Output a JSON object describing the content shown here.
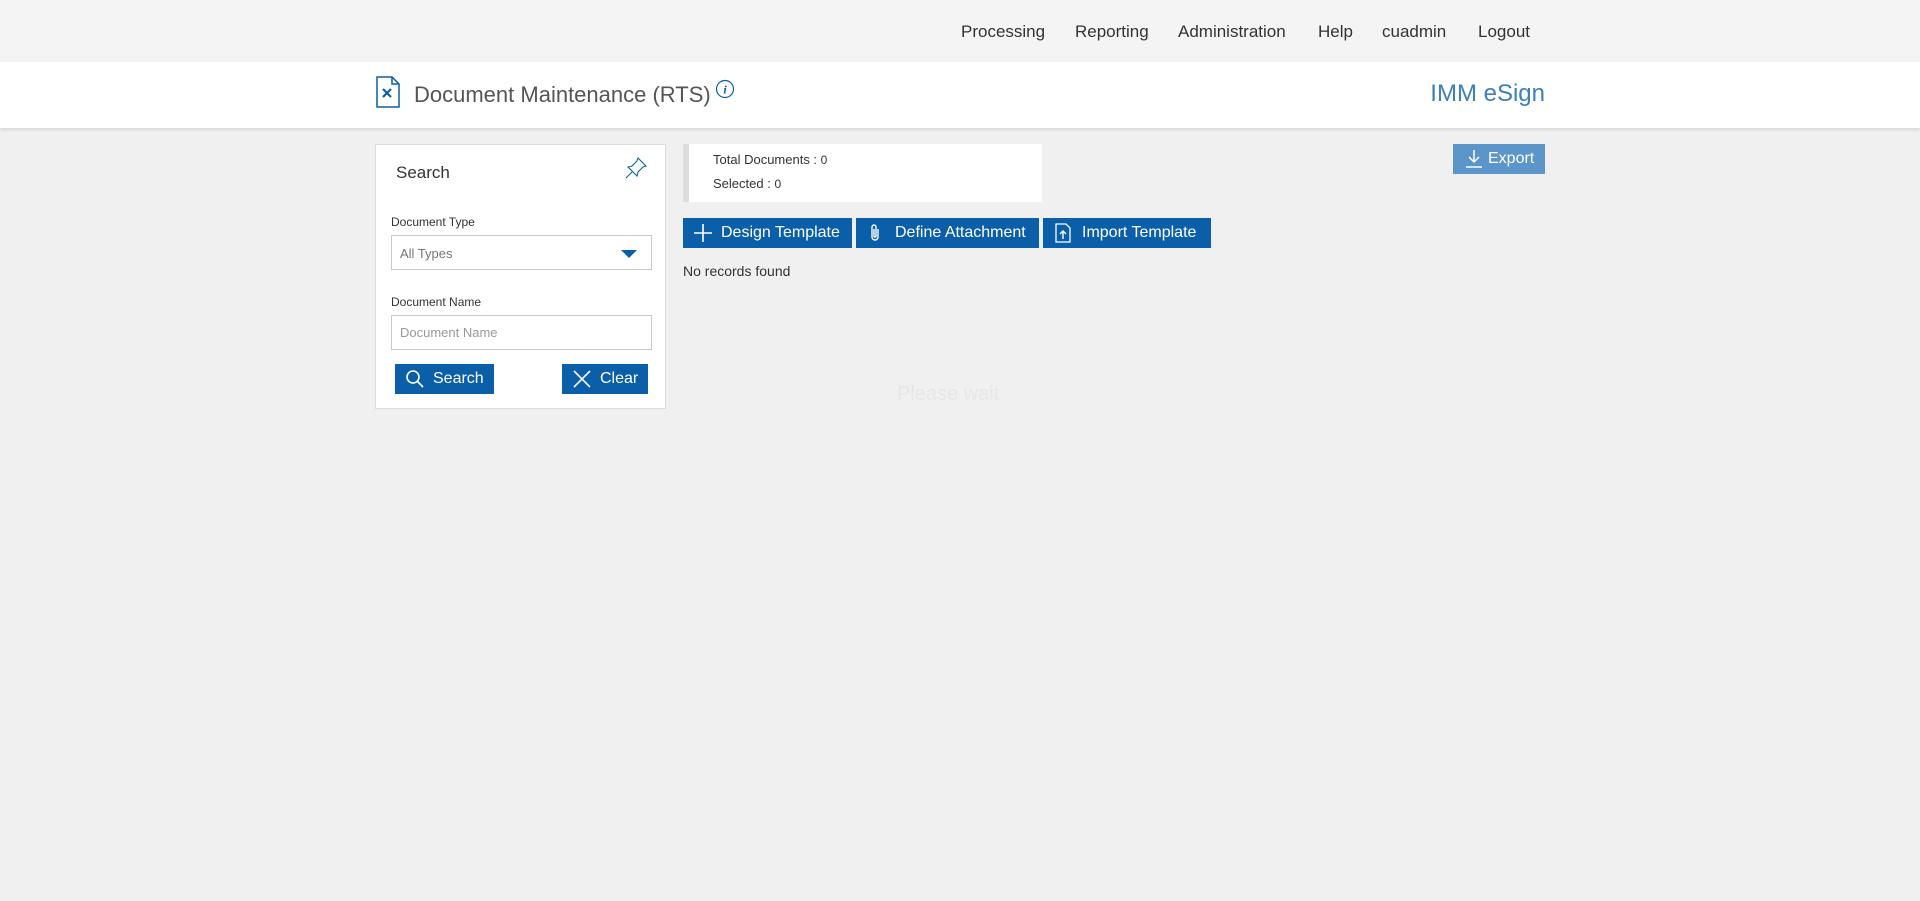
{
  "nav": {
    "items": [
      "Processing",
      "Reporting",
      "Administration",
      "Help",
      "cuadmin",
      "Logout"
    ]
  },
  "header": {
    "title": "Document Maintenance (RTS)",
    "brand": "IMM eSign",
    "icons": [
      "document-icon",
      "info-icon"
    ]
  },
  "search": {
    "title": "Search",
    "document_type_label": "Document Type",
    "document_type_value": "All Types",
    "document_name_label": "Document Name",
    "document_name_placeholder": "Document Name",
    "search_button": "Search",
    "clear_button": "Clear"
  },
  "summary": {
    "total_label": "Total Documents : ",
    "total_value": "0",
    "selected_label": "Selected : ",
    "selected_value": "0"
  },
  "actions": {
    "design_template": "Design Template",
    "define_attachment": "Define Attachment",
    "import_template": "Import Template",
    "export": "Export"
  },
  "results": {
    "empty_message": "No records found",
    "loading_message": "Please wait"
  },
  "colors": {
    "primary": "#0b5fa8",
    "export": "#5b95c9",
    "brand": "#3d7fb8"
  }
}
